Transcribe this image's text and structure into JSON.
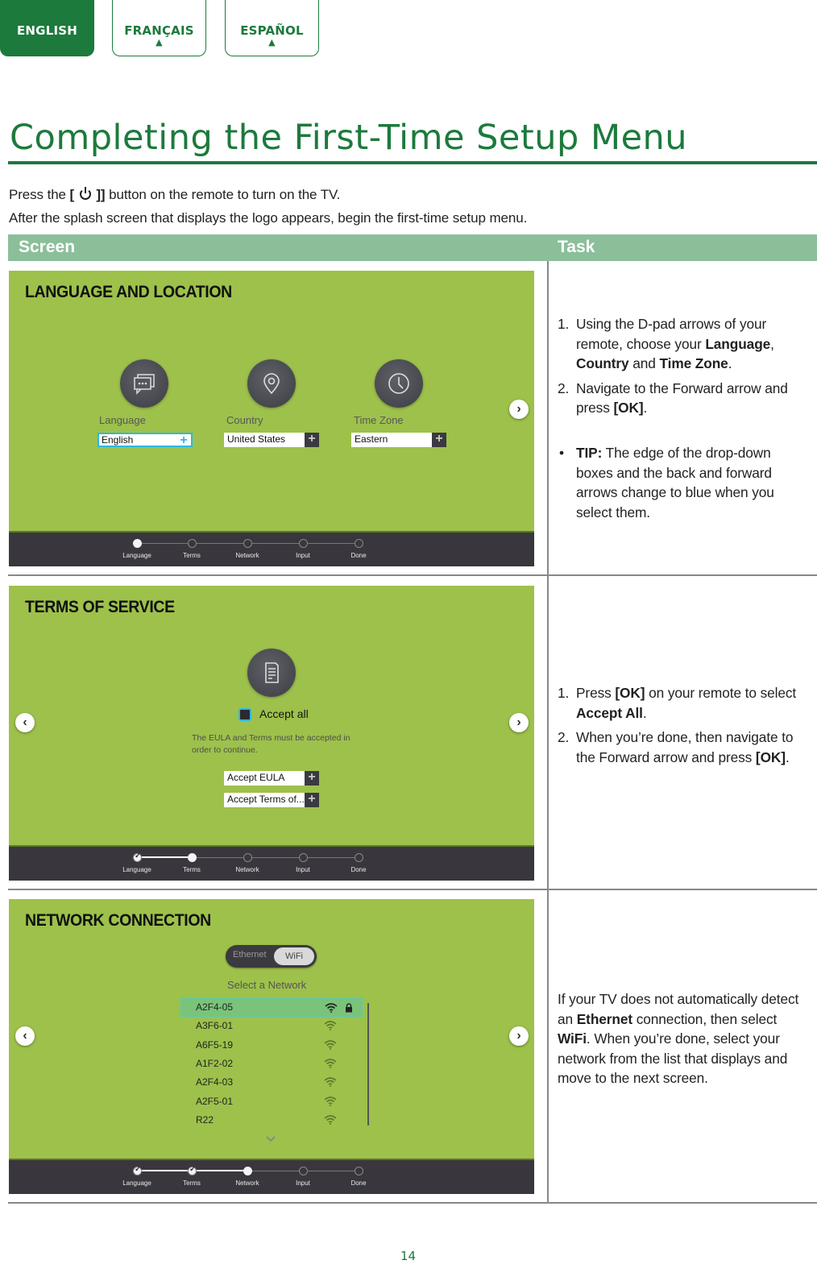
{
  "language_tabs": [
    {
      "label": "ENGLISH",
      "active": true
    },
    {
      "label": "FRANÇAIS",
      "active": false,
      "marker": "▲"
    },
    {
      "label": "ESPAÑOL",
      "active": false,
      "marker": "▲"
    }
  ],
  "page_title": "Completing the First-Time Setup Menu",
  "intro": {
    "line1_before": "Press the ",
    "line1_button_open": "[",
    "line1_button_close": "]]",
    "line1_after": " button on the remote to turn on the TV.",
    "line2": "After the splash screen that displays the logo appears, begin the first-time setup menu."
  },
  "table": {
    "headers": {
      "screen": "Screen",
      "task": "Task"
    }
  },
  "steps": [
    "Language",
    "Terms",
    "Network",
    "Input",
    "Done"
  ],
  "screen1": {
    "title": "LANGUAGE AND LOCATION",
    "fields": [
      {
        "label": "Language",
        "value": "English",
        "icon": "chat-bubbles-icon",
        "selected": true
      },
      {
        "label": "Country",
        "value": "United States",
        "icon": "location-pin-icon",
        "selected": false
      },
      {
        "label": "Time Zone",
        "value": "Eastern",
        "icon": "clock-icon",
        "selected": false
      }
    ],
    "plus": "+",
    "forward_arrow": "›",
    "current_step": 0
  },
  "screen2": {
    "title": "TERMS OF SERVICE",
    "accept_all": "Accept all",
    "note": "The EULA and Terms must be accepted in order to continue.",
    "dropdowns": [
      "Accept EULA",
      "Accept Terms of..."
    ],
    "plus": "+",
    "back_arrow": "‹",
    "forward_arrow": "›",
    "current_step": 1
  },
  "screen3": {
    "title": "NETWORK CONNECTION",
    "toggle": {
      "option1": "Ethernet",
      "option2": "WiFi",
      "selected": "WiFi"
    },
    "select_label": "Select a Network",
    "networks": [
      {
        "name": "A2F4-05",
        "locked": true,
        "selected": true
      },
      {
        "name": "A3F6-01",
        "locked": false,
        "selected": false
      },
      {
        "name": "A6F5-19",
        "locked": false,
        "selected": false
      },
      {
        "name": "A1F2-02",
        "locked": false,
        "selected": false
      },
      {
        "name": "A2F4-03",
        "locked": false,
        "selected": false
      },
      {
        "name": "A2F5-01",
        "locked": false,
        "selected": false
      },
      {
        "name": "R22",
        "locked": false,
        "selected": false
      }
    ],
    "more_chevron": "⌄",
    "back_arrow": "‹",
    "forward_arrow": "›",
    "current_step": 2
  },
  "task1": {
    "items": [
      {
        "num": "1.",
        "parts": [
          "Using the D-pad arrows of your remote, choose your ",
          "Language",
          ", ",
          "Country",
          " and ",
          "Time Zone",
          "."
        ]
      },
      {
        "num": "2.",
        "parts": [
          "Navigate to the Forward arrow and press ",
          "[OK]",
          "."
        ]
      }
    ],
    "tip_bullet": "•",
    "tip_label": "TIP:",
    "tip_text": " The edge of the drop-down boxes and the back and forward arrows change to blue when you select them."
  },
  "task2": {
    "items": [
      {
        "num": "1.",
        "parts": [
          "Press ",
          "[OK]",
          " on your remote to select ",
          "Accept All",
          "."
        ]
      },
      {
        "num": "2.",
        "parts": [
          "When you’re done, then navigate to the Forward arrow and press ",
          "[OK]",
          "."
        ]
      }
    ]
  },
  "task3": {
    "parts": [
      "If your TV does not automatically detect an ",
      "Ethernet",
      " connection, then select ",
      "WiFi",
      ". When you’re done, select your network from the list that displays and move to the next screen."
    ]
  },
  "page_number": "14"
}
